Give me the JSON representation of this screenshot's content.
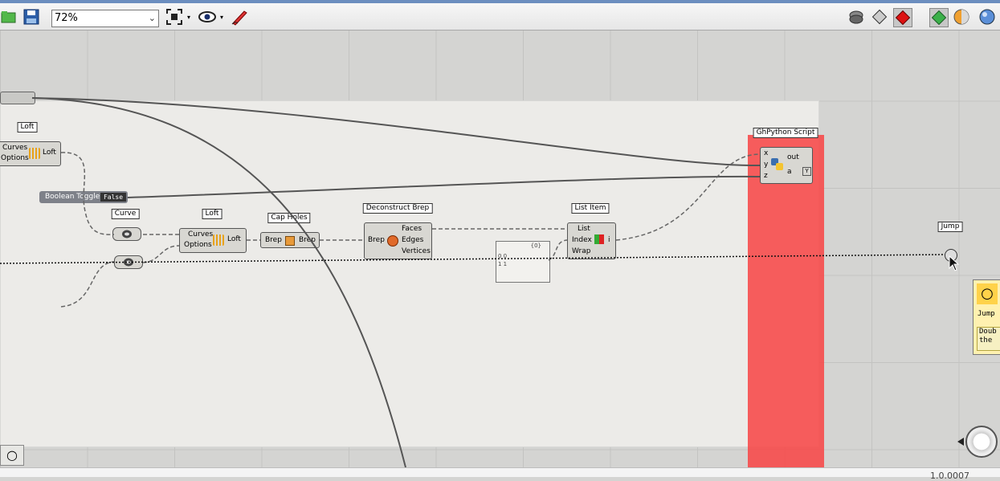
{
  "toolbar": {
    "zoom": "72%",
    "icons": [
      "open-file-icon",
      "save-icon",
      "zoom-extents-icon",
      "preview-eye-icon",
      "sketch-pen-icon",
      "wire-display-icon",
      "mesh-display-icon",
      "shaded-display-icon",
      "green-display-icon",
      "color-sphere-icon",
      "blue-sphere-icon"
    ]
  },
  "components": {
    "loft_top": {
      "label": "Loft",
      "in1": "Curves",
      "in2": "Options",
      "out": "Loft"
    },
    "loft_bottom": {
      "label": "Loft",
      "in1": "Curves",
      "in2": "Options",
      "out": "Loft"
    },
    "boolean_toggle": {
      "label": "Boolean Toggle",
      "value": "False"
    },
    "curve": {
      "label": "Curve"
    },
    "loft_mid": {
      "label": "Loft",
      "in1": "Curves",
      "in2": "Options",
      "out": "Loft"
    },
    "cap_holes": {
      "label": "Cap Holes",
      "in": "Brep",
      "out": "Brep"
    },
    "deconstruct_brep": {
      "label": "Deconstruct Brep",
      "in": "Brep",
      "out1": "Faces",
      "out2": "Edges",
      "out3": "Vertices"
    },
    "panel": {
      "line1": "{0}",
      "line2": "0 0",
      "line3": "1 1"
    },
    "list_item": {
      "label": "List Item",
      "in1": "List",
      "in2": "Index",
      "in3": "Wrap",
      "out": "i"
    },
    "ghpython": {
      "label": "GhPython Script",
      "in1": "x",
      "in2": "y",
      "in3": "z",
      "out1": "out",
      "out2": "a"
    },
    "jump": {
      "label": "Jump"
    }
  },
  "tooltip": {
    "title": "Jump",
    "desc_line1": "Doub",
    "desc_line2": "the"
  },
  "status": {
    "version": "1.0.0007"
  }
}
